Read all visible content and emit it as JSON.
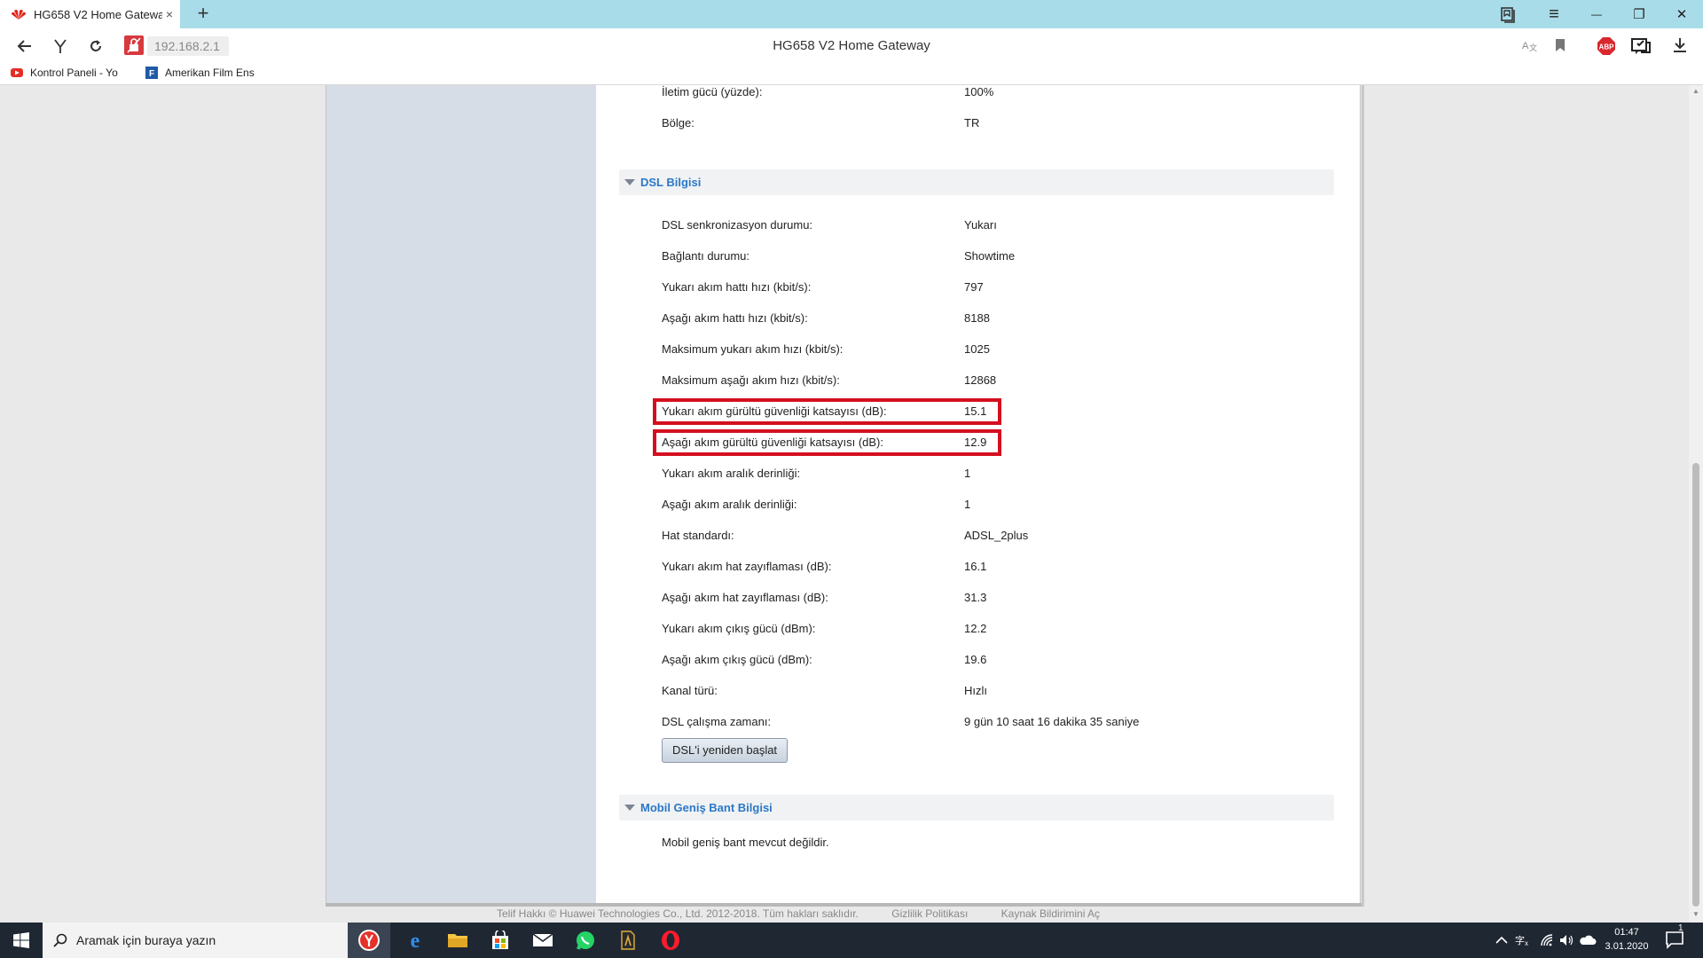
{
  "browser": {
    "tab_title": "HG658 V2 Home Gateway",
    "tab_close": "×",
    "new_tab": "+",
    "url": "192.168.2.1",
    "page_title": "HG658 V2 Home Gateway",
    "win_minimize": "—",
    "win_restore": "❐",
    "win_close": "✕",
    "menu": "≡"
  },
  "bookmarks": [
    {
      "label": "Kontrol Paneli - Yo"
    },
    {
      "label": "Amerikan Film Ens"
    }
  ],
  "page": {
    "top_rows": [
      {
        "label": "İletim gücü (yüzde):",
        "value": "100%"
      },
      {
        "label": "Bölge:",
        "value": "TR"
      }
    ],
    "dsl_section_title": "DSL Bilgisi",
    "dsl_rows": [
      {
        "label": "DSL senkronizasyon durumu:",
        "value": "Yukarı"
      },
      {
        "label": "Bağlantı durumu:",
        "value": "Showtime"
      },
      {
        "label": "Yukarı akım hattı hızı (kbit/s):",
        "value": "797"
      },
      {
        "label": "Aşağı akım hattı hızı (kbit/s):",
        "value": "8188"
      },
      {
        "label": "Maksimum yukarı akım hızı (kbit/s):",
        "value": "1025"
      },
      {
        "label": "Maksimum aşağı akım hızı (kbit/s):",
        "value": "12868"
      },
      {
        "label": "Yukarı akım gürültü güvenliği katsayısı (dB):",
        "value": "15.1"
      },
      {
        "label": "Aşağı akım gürültü güvenliği katsayısı (dB):",
        "value": "12.9"
      },
      {
        "label": "Yukarı akım aralık derinliği:",
        "value": "1"
      },
      {
        "label": "Aşağı akım aralık derinliği:",
        "value": "1"
      },
      {
        "label": "Hat standardı:",
        "value": "ADSL_2plus"
      },
      {
        "label": "Yukarı akım hat zayıflaması (dB):",
        "value": "16.1"
      },
      {
        "label": "Aşağı akım hat zayıflaması (dB):",
        "value": "31.3"
      },
      {
        "label": "Yukarı akım çıkış gücü (dBm):",
        "value": "12.2"
      },
      {
        "label": "Aşağı akım çıkış gücü (dBm):",
        "value": "19.6"
      },
      {
        "label": "Kanal türü:",
        "value": "Hızlı"
      },
      {
        "label": "DSL çalışma zamanı:",
        "value": "9 gün 10 saat 16 dakika 35 saniye"
      }
    ],
    "restart_button": "DSL'i yeniden başlat",
    "mobile_section_title": "Mobil Geniş Bant Bilgisi",
    "mobile_text": "Mobil geniş bant mevcut değildir."
  },
  "footer": {
    "copyright": "Telif Hakkı © Huawei Technologies Co., Ltd. 2012-2018. Tüm hakları saklıdır.",
    "privacy": "Gizlilik Politikası",
    "source": "Kaynak Bildirimini Aç"
  },
  "taskbar": {
    "search_placeholder": "Aramak için buraya yazın",
    "time": "01:47",
    "date": "3.01.2020",
    "notification_count": "1"
  },
  "colors": {
    "highlight": "#d40f1f",
    "section_title": "#2b78c7",
    "tabbar": "#a8dce8"
  }
}
